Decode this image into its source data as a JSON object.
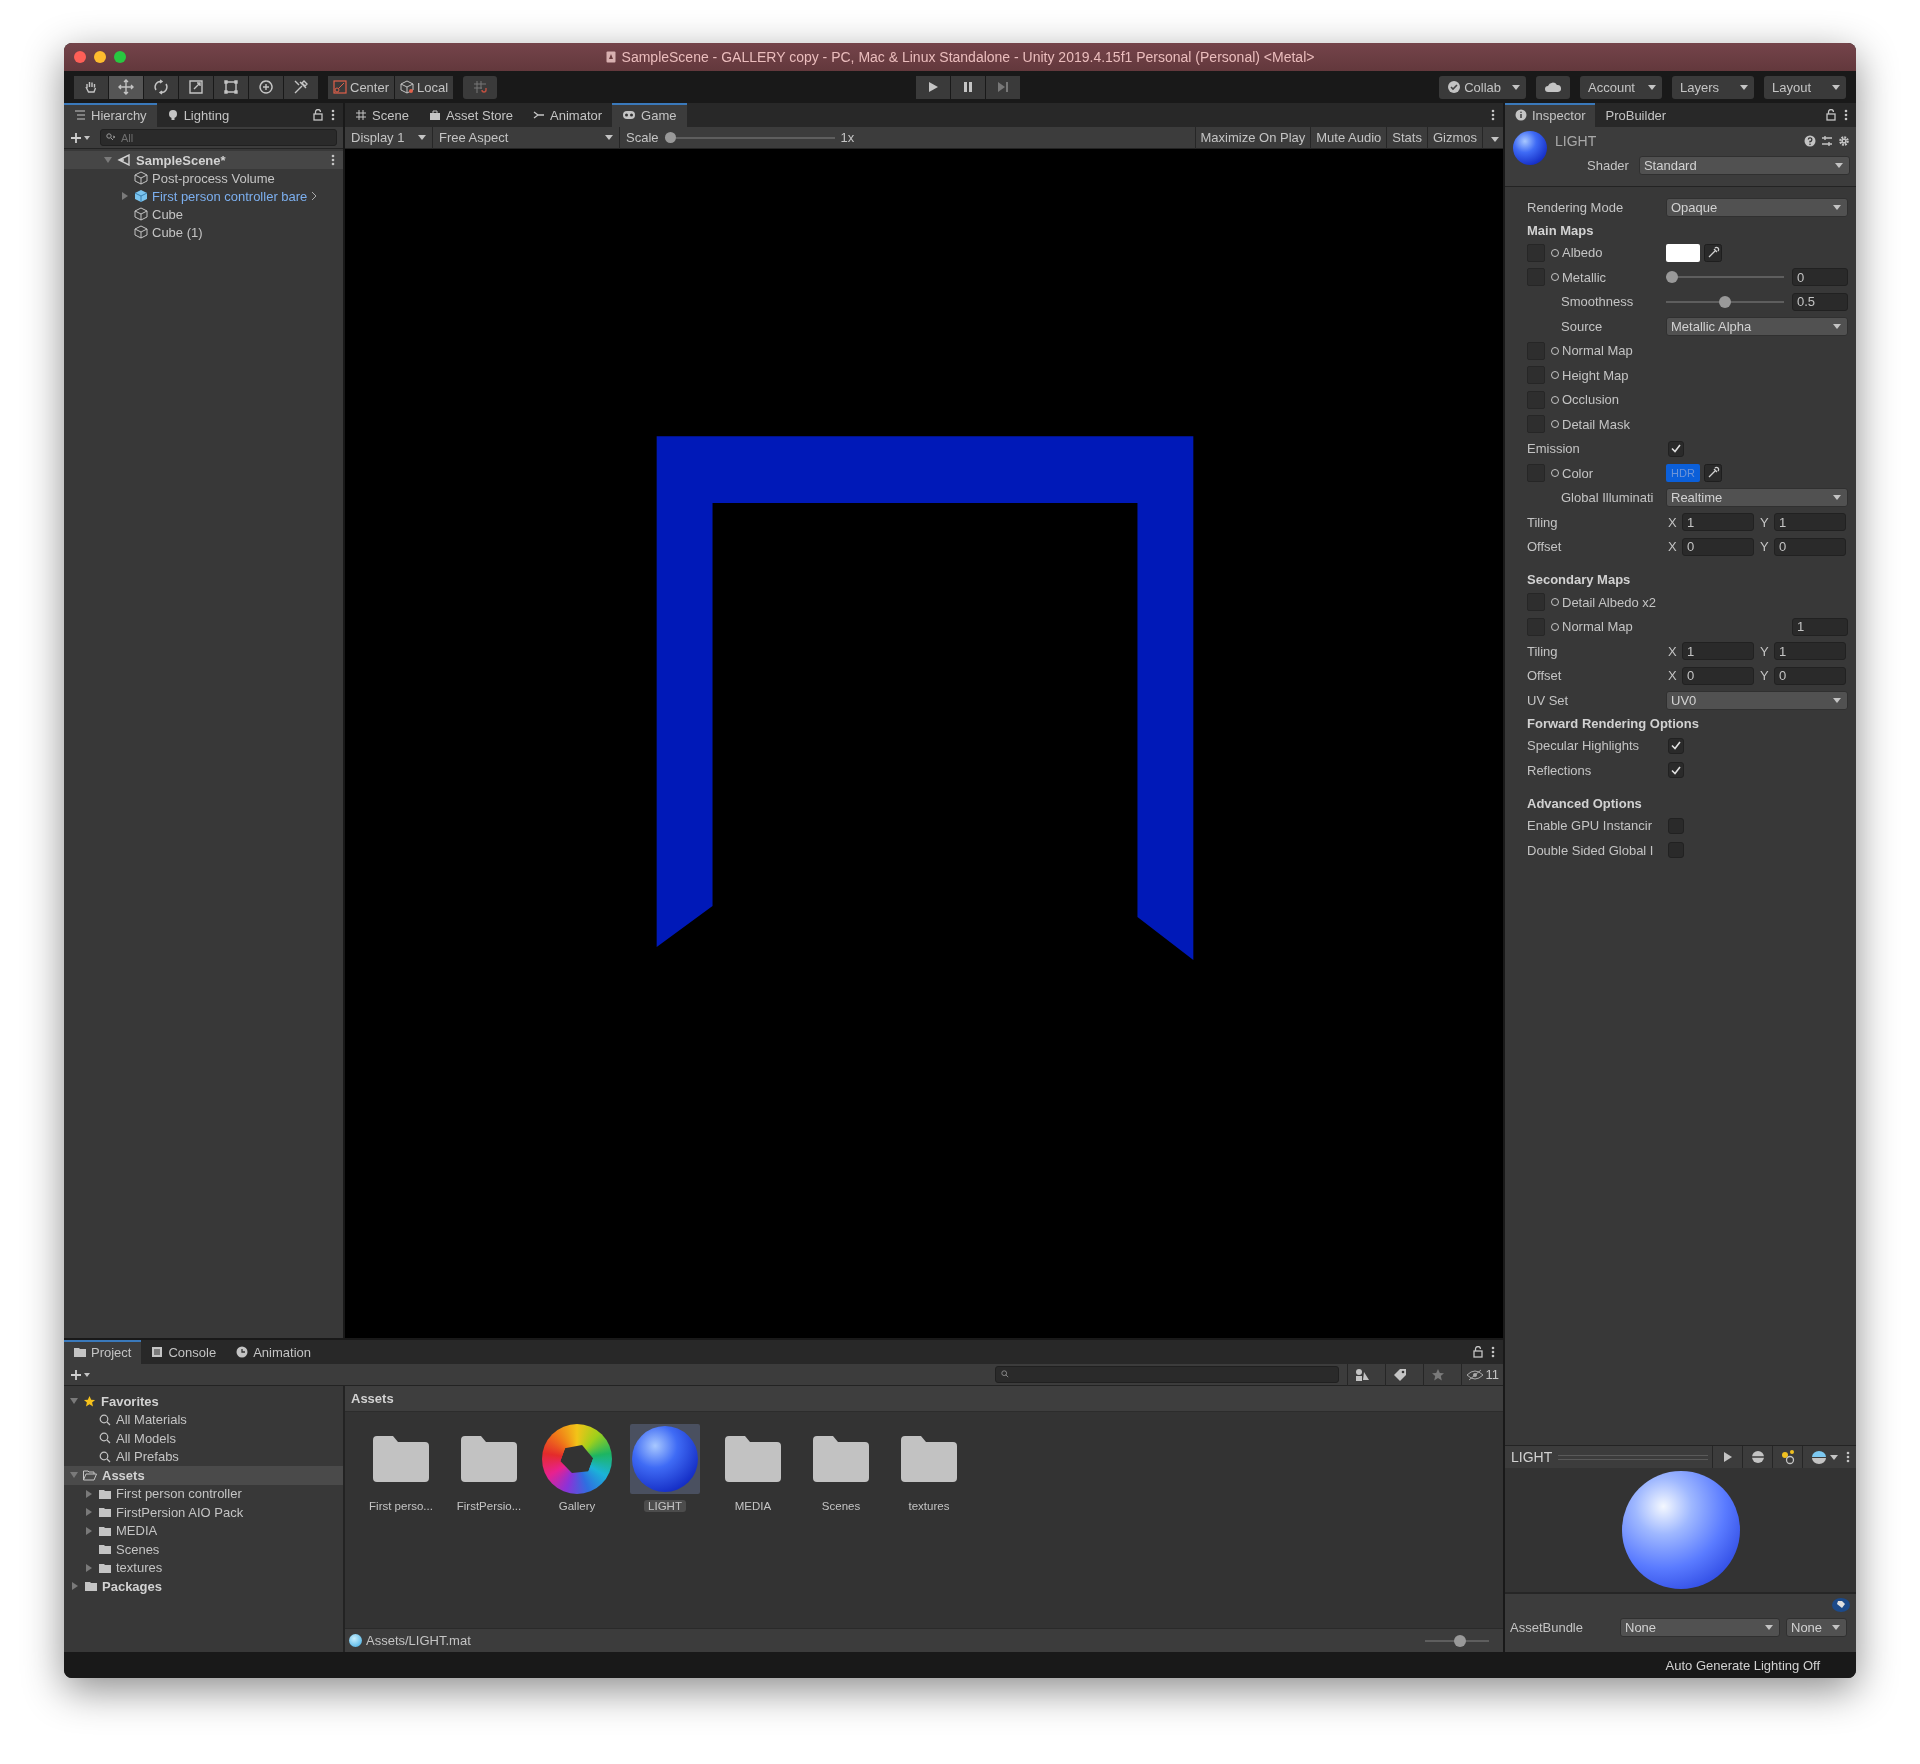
{
  "window": {
    "title": "SampleScene - GALLERY copy - PC, Mac & Linux Standalone - Unity 2019.4.15f1 Personal (Personal) <Metal>"
  },
  "toolbar": {
    "tools": [
      {
        "kind": "hand",
        "selected": false
      },
      {
        "kind": "move",
        "selected": true
      },
      {
        "kind": "rotate",
        "selected": false
      },
      {
        "kind": "scale",
        "selected": false
      },
      {
        "kind": "rect",
        "selected": false
      },
      {
        "kind": "transform",
        "selected": false
      },
      {
        "kind": "custom",
        "selected": false
      }
    ],
    "pivot": "Center",
    "handle": "Local",
    "collab": "Collab",
    "account": "Account",
    "layers": "Layers",
    "layout": "Layout"
  },
  "hierarchy": {
    "tabs": [
      {
        "label": "Hierarchy",
        "kind": "list",
        "selected": true
      },
      {
        "label": "Lighting",
        "kind": "bulb",
        "selected": false
      }
    ],
    "search": {
      "placeholder": "All"
    },
    "scene": {
      "name": "SampleScene*",
      "children": [
        {
          "name": "Post-process Volume",
          "kind": "object"
        },
        {
          "name": "First person controller bare",
          "kind": "prefab",
          "expanded": false
        },
        {
          "name": "Cube",
          "kind": "object"
        },
        {
          "name": "Cube (1)",
          "kind": "object"
        }
      ]
    }
  },
  "game": {
    "tabs": [
      {
        "label": "Scene",
        "kind": "grid",
        "selected": false
      },
      {
        "label": "Asset Store",
        "kind": "bag",
        "selected": false
      },
      {
        "label": "Animator",
        "kind": "anim",
        "selected": false
      },
      {
        "label": "Game",
        "kind": "pad",
        "selected": true
      }
    ],
    "display": "Display 1",
    "aspect": "Free Aspect",
    "scale_label": "Scale",
    "scale": {
      "level": 0,
      "reading": "1x"
    },
    "toggles": [
      {
        "label": "Maximize On Play",
        "on": false
      },
      {
        "label": "Mute Audio",
        "on": false
      },
      {
        "label": "Stats",
        "on": false
      },
      {
        "label": "Gizmos",
        "on": false
      }
    ]
  },
  "inspector": {
    "tabs": [
      {
        "label": "Inspector",
        "selected": true
      },
      {
        "label": "ProBuilder",
        "selected": false
      }
    ],
    "name": "LIGHT",
    "shader_label": "Shader",
    "shader": "Standard",
    "properties": [
      {
        "kind": "dropdown",
        "label": "Rendering Mode",
        "value": "Opaque"
      },
      {
        "kind": "heading",
        "label": "Main Maps"
      },
      {
        "kind": "color",
        "label": "Albedo",
        "color": "#ffffff"
      },
      {
        "kind": "slider",
        "label": "Metallic",
        "level": 0,
        "value": "0",
        "children": [
          {
            "kind": "slider",
            "label": "Smoothness",
            "level": 0.5,
            "value": "0.5"
          },
          {
            "kind": "dropdown",
            "label": "Source",
            "value": "Metallic Alpha"
          }
        ]
      },
      {
        "kind": "texture",
        "label": "Normal Map"
      },
      {
        "kind": "texture",
        "label": "Height Map"
      },
      {
        "kind": "texture",
        "label": "Occlusion"
      },
      {
        "kind": "texture",
        "label": "Detail Mask"
      },
      {
        "kind": "checkbox",
        "label": "Emission",
        "checked": true
      },
      {
        "kind": "color",
        "label": "Color",
        "color": "#0b5fd9",
        "badge": "HDR",
        "children": [
          {
            "kind": "dropdown",
            "label": "Global Illuminati",
            "value": "Realtime"
          }
        ]
      },
      {
        "kind": "vector",
        "label": "Tiling",
        "components": [
          {
            "axis": "X",
            "value": "1"
          },
          {
            "axis": "Y",
            "value": "1"
          }
        ]
      },
      {
        "kind": "vector",
        "label": "Offset",
        "components": [
          {
            "axis": "X",
            "value": "0"
          },
          {
            "axis": "Y",
            "value": "0"
          }
        ]
      },
      {
        "kind": "heading",
        "label": "Secondary Maps"
      },
      {
        "kind": "texture",
        "label": "Detail Albedo x2"
      },
      {
        "kind": "texture",
        "label": "Normal Map",
        "value": "1"
      },
      {
        "kind": "vector",
        "label": "Tiling",
        "components": [
          {
            "axis": "X",
            "value": "1"
          },
          {
            "axis": "Y",
            "value": "1"
          }
        ]
      },
      {
        "kind": "vector",
        "label": "Offset",
        "components": [
          {
            "axis": "X",
            "value": "0"
          },
          {
            "axis": "Y",
            "value": "0"
          }
        ]
      },
      {
        "kind": "dropdown",
        "label": "UV Set",
        "value": "UV0"
      },
      {
        "kind": "heading",
        "label": "Forward Rendering Options"
      },
      {
        "kind": "checkbox",
        "label": "Specular Highlights",
        "checked": true
      },
      {
        "kind": "checkbox",
        "label": "Reflections",
        "checked": true
      },
      {
        "kind": "heading",
        "label": "Advanced Options"
      },
      {
        "kind": "checkbox",
        "label": "Enable GPU Instancir",
        "checked": false
      },
      {
        "kind": "checkbox",
        "label": "Double Sided Global I",
        "checked": false
      }
    ],
    "preview": {
      "title": "LIGHT"
    },
    "asset_bundle": {
      "label": "AssetBundle",
      "name": "None",
      "variant": "None"
    }
  },
  "project": {
    "tabs": [
      {
        "label": "Project",
        "kind": "folder",
        "selected": true
      },
      {
        "label": "Console",
        "kind": "console",
        "selected": false
      },
      {
        "label": "Animation",
        "kind": "clock",
        "selected": false
      }
    ],
    "hidden_count": "11",
    "tree": [
      {
        "name": "Favorites",
        "kind": "star",
        "selected": false,
        "children": [
          {
            "name": "All Materials",
            "kind": "search"
          },
          {
            "name": "All Models",
            "kind": "search"
          },
          {
            "name": "All Prefabs",
            "kind": "search"
          }
        ]
      },
      {
        "name": "Assets",
        "kind": "openfolder",
        "selected": true,
        "children": [
          {
            "name": "First person controller",
            "kind": "folder",
            "expanded": false
          },
          {
            "name": "FirstPersion AIO Pack",
            "kind": "folder",
            "expanded": false
          },
          {
            "name": "MEDIA",
            "kind": "folder",
            "expanded": false
          },
          {
            "name": "Scenes",
            "kind": "folder"
          },
          {
            "name": "textures",
            "kind": "folder",
            "expanded": false
          }
        ]
      },
      {
        "name": "Packages",
        "kind": "folder",
        "selected": false,
        "expanded": false
      }
    ],
    "breadcrumb": "Assets",
    "items": [
      {
        "label": "First perso...",
        "kind": "folder",
        "selected": false
      },
      {
        "label": "FirstPersio...",
        "kind": "folder",
        "selected": false
      },
      {
        "label": "Gallery",
        "kind": "aperture",
        "selected": false
      },
      {
        "label": "LIGHT",
        "kind": "material",
        "selected": true
      },
      {
        "label": "MEDIA",
        "kind": "folder",
        "selected": false
      },
      {
        "label": "Scenes",
        "kind": "folder",
        "selected": false
      },
      {
        "label": "textures",
        "kind": "folder",
        "selected": false
      }
    ],
    "path": "Assets/LIGHT.mat",
    "zoom": {
      "level": 0.55
    }
  },
  "status_bar": {
    "text": "Auto Generate Lighting Off"
  }
}
